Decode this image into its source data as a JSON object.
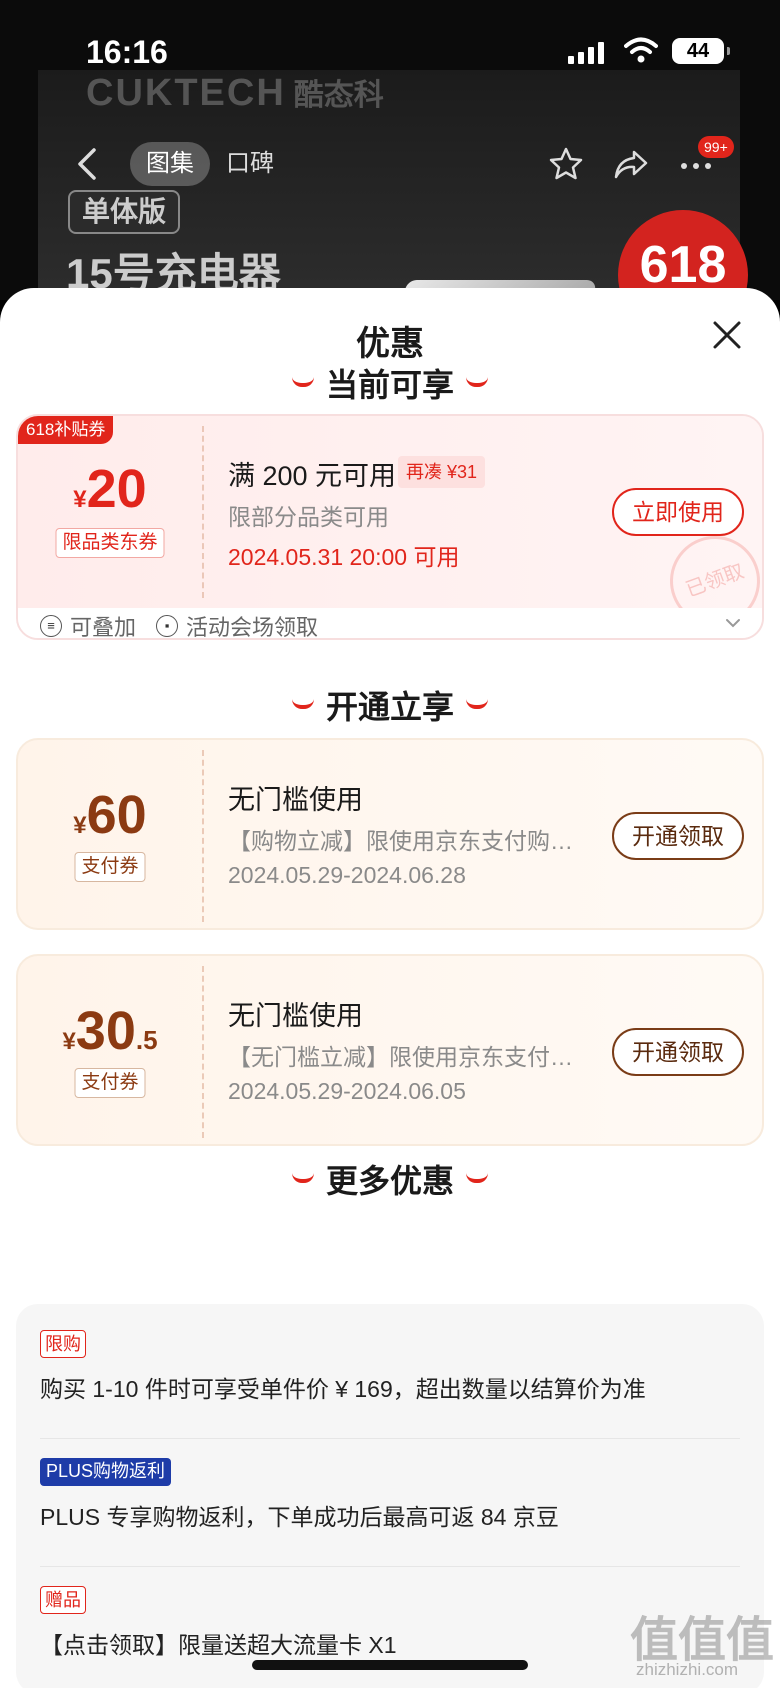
{
  "status_bar": {
    "time": "16:16",
    "battery": "44"
  },
  "header": {
    "brand": "CUKTECH",
    "brand_cn": "酷态科",
    "tabs": [
      {
        "label": "图集",
        "active": true
      },
      {
        "label": "口碑",
        "active": false
      }
    ],
    "more_badge": "99+",
    "banner_tag": "单体版",
    "banner_title": "15号充电器",
    "banner_badge": "618"
  },
  "sheet": {
    "title": "优惠",
    "sections": {
      "current": "当前可享",
      "open": "开通立享",
      "more": "更多优惠"
    }
  },
  "coupons": [
    {
      "corner_tag": "618补贴券",
      "currency": "¥",
      "amount": "20",
      "type": "限品类东券",
      "title": "满 200 元可用",
      "extra": "再凑 ¥31",
      "desc": "限部分品类可用",
      "date": "2024.05.31 20:00 可用",
      "button": "立即使用",
      "stamp": "已领取",
      "footer": {
        "stackable": "可叠加",
        "source": "活动会场领取"
      }
    },
    {
      "currency": "¥",
      "amount": "60",
      "type": "支付券",
      "title": "无门槛使用",
      "desc": "【购物立减】限使用京东支付购…",
      "date": "2024.05.29-2024.06.28",
      "button": "开通领取"
    },
    {
      "currency": "¥",
      "amount": "30",
      "amount_decimal": ".5",
      "type": "支付券",
      "title": "无门槛使用",
      "desc": "【无门槛立减】限使用京东支付…",
      "date": "2024.05.29-2024.06.05",
      "button": "开通领取"
    }
  ],
  "more_offers": [
    {
      "tag": "限购",
      "text": "购买 1-10 件时可享受单件价 ¥ 169，超出数量以结算价为准"
    },
    {
      "tag": "PLUS购物返利",
      "text": "PLUS 专享购物返利，下单成功后最高可返 84 京豆"
    },
    {
      "tag": "赠品",
      "text": "【点击领取】限量送超大流量卡 X1"
    }
  ],
  "watermark": {
    "main": "值值值",
    "sub": "zhizhizhi.com"
  },
  "colors": {
    "accent": "#e1251b",
    "brown": "#8b3a12",
    "plus_blue": "#1e3ca8"
  }
}
